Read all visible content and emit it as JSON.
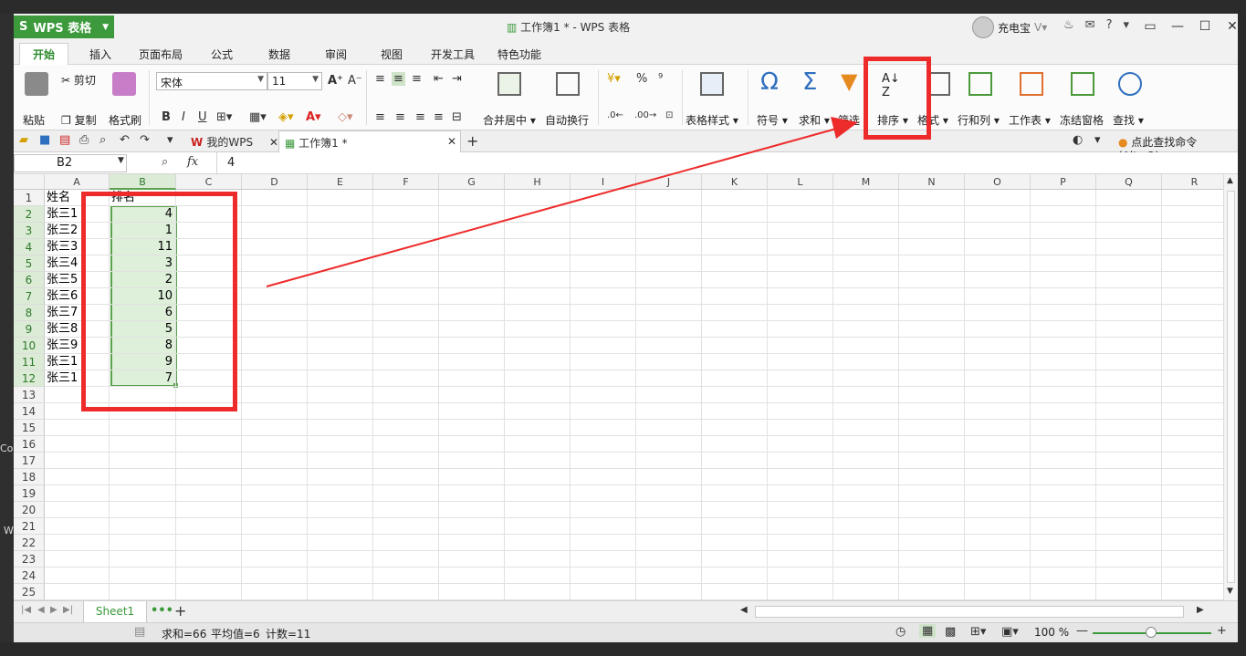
{
  "window": {
    "app_button": "WPS 表格",
    "app_logo": "S",
    "title": "工作簿1 * - WPS 表格",
    "user_name": "充电宝",
    "controls": [
      "▭",
      "—",
      "☐",
      "✕"
    ]
  },
  "tabs": [
    "开始",
    "插入",
    "页面布局",
    "公式",
    "数据",
    "审阅",
    "视图",
    "开发工具",
    "特色功能"
  ],
  "ribbon": {
    "paste": "粘贴",
    "cut": "剪切",
    "copy": "复制",
    "format_painter": "格式刷",
    "font_name": "宋体",
    "font_size": "11",
    "merge_center": "合并居中",
    "auto_wrap": "自动换行",
    "table_style": "表格样式",
    "symbol": "符号",
    "sum": "求和",
    "filter": "筛选",
    "sort": "排序",
    "format": "格式",
    "row_col": "行和列",
    "worksheet": "工作表",
    "freeze": "冻结窗格",
    "find": "查找",
    "bold": "B",
    "italic": "I",
    "underline": "U",
    "percent": "%",
    "comma": "⁹"
  },
  "doc_tabs": {
    "my_wps": "我的WPS",
    "workbook": "工作簿1 *",
    "search_command": "点此查找命令 (Alt+Q)"
  },
  "formula_bar": {
    "name_box": "B2",
    "fx": "fx",
    "value": "4"
  },
  "sheet": {
    "columns": [
      "A",
      "B",
      "C",
      "D",
      "E",
      "F",
      "G",
      "H",
      "I",
      "J",
      "K",
      "L",
      "M",
      "N",
      "O",
      "P",
      "Q",
      "R"
    ],
    "rows": [
      "1",
      "2",
      "3",
      "4",
      "5",
      "6",
      "7",
      "8",
      "9",
      "10",
      "11",
      "12",
      "13",
      "14",
      "15",
      "16",
      "17",
      "18",
      "19",
      "20",
      "21",
      "22",
      "23",
      "24",
      "25"
    ],
    "header_a": "姓名",
    "header_b": "排名",
    "names": [
      "张三1",
      "张三2",
      "张三3",
      "张三4",
      "张三5",
      "张三6",
      "张三7",
      "张三8",
      "张三9",
      "张三1",
      "张三1"
    ],
    "ranks": [
      "4",
      "1",
      "11",
      "3",
      "2",
      "10",
      "6",
      "5",
      "8",
      "9",
      "7"
    ],
    "tab_name": "Sheet1"
  },
  "status": {
    "sum": "求和=66",
    "avg": "平均值=6",
    "count": "计数=11",
    "zoom": "100 %"
  },
  "desktop": {
    "left_text_1": "Co",
    "left_text_2": "W"
  },
  "colors": {
    "accent_green": "#3c9a3c",
    "selection_green": "#5ba24f",
    "annotation_red": "#ee2b2b"
  }
}
